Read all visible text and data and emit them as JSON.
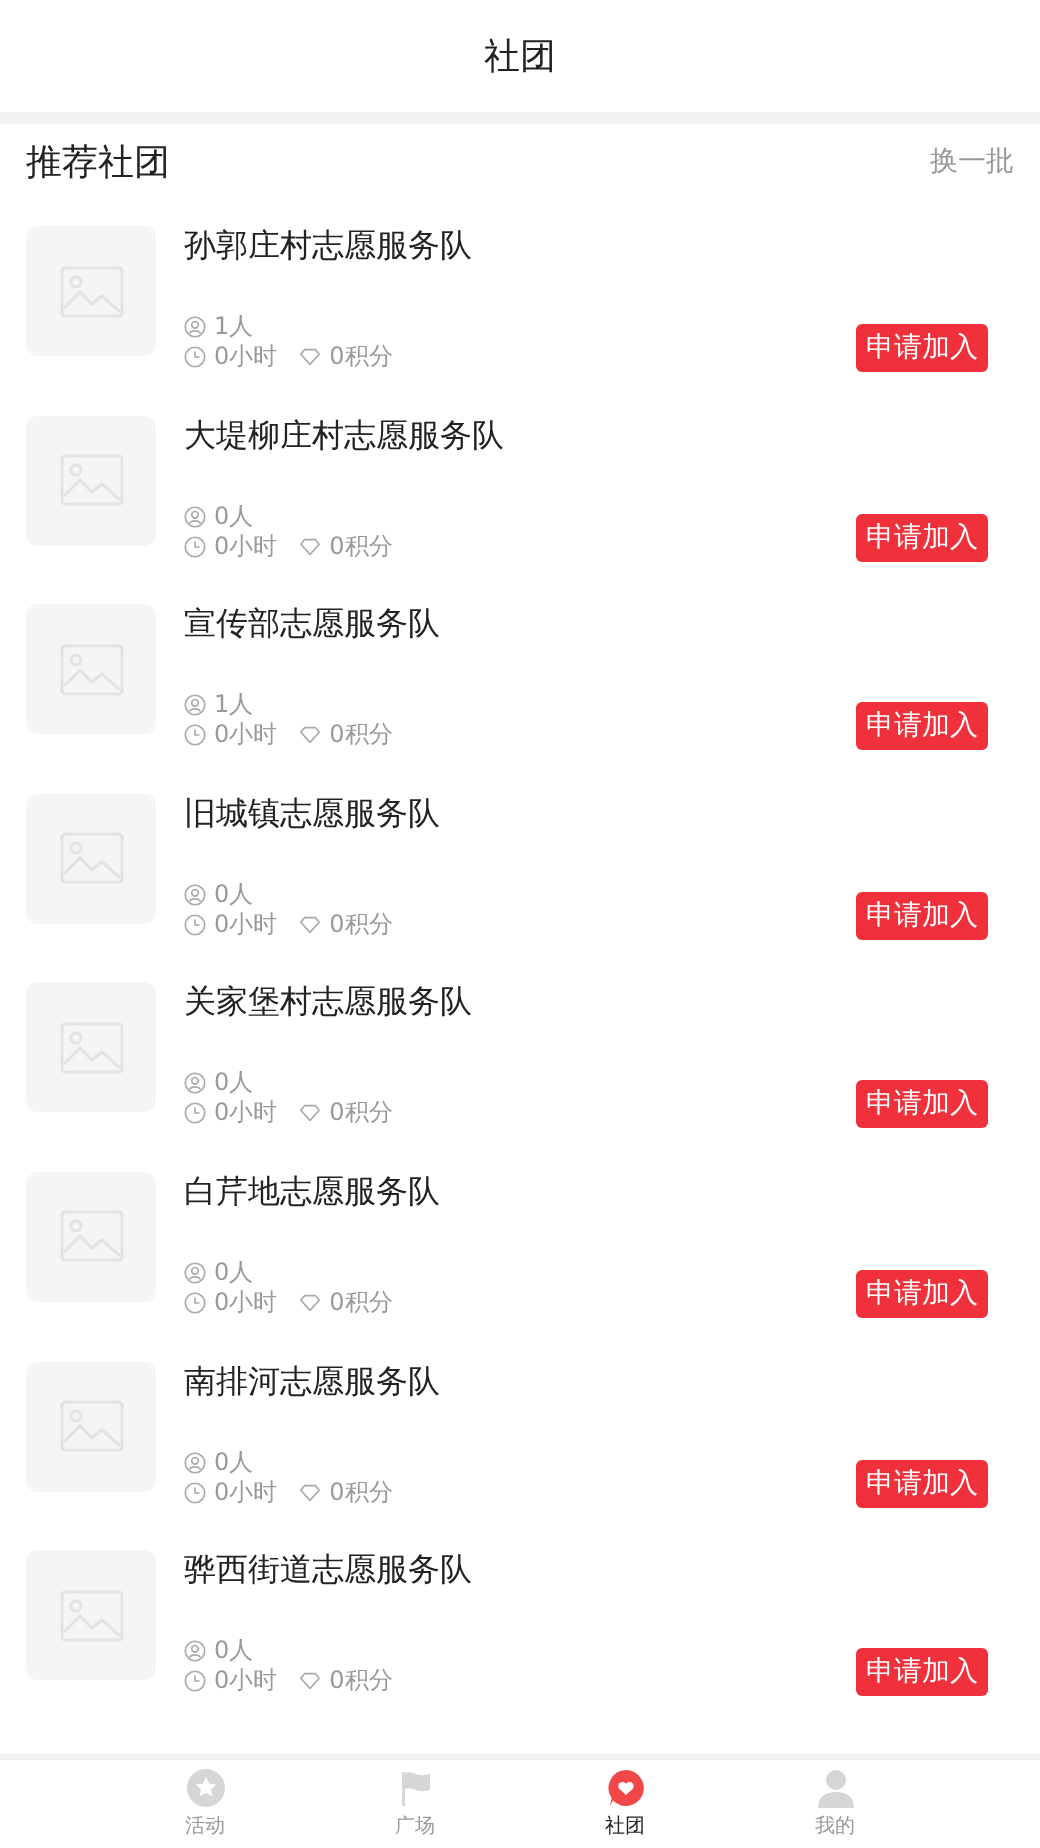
{
  "header": {
    "title": "社团"
  },
  "section": {
    "title": "推荐社团",
    "action": "换一批"
  },
  "clubs": [
    {
      "name": "孙郭庄村志愿服务队",
      "members": "1人",
      "hours": "0小时",
      "points": "0积分",
      "button": "申请加入"
    },
    {
      "name": "大堤柳庄村志愿服务队",
      "members": "0人",
      "hours": "0小时",
      "points": "0积分",
      "button": "申请加入"
    },
    {
      "name": "宣传部志愿服务队",
      "members": "1人",
      "hours": "0小时",
      "points": "0积分",
      "button": "申请加入"
    },
    {
      "name": "旧城镇志愿服务队",
      "members": "0人",
      "hours": "0小时",
      "points": "0积分",
      "button": "申请加入"
    },
    {
      "name": "关家堡村志愿服务队",
      "members": "0人",
      "hours": "0小时",
      "points": "0积分",
      "button": "申请加入"
    },
    {
      "name": "白芹地志愿服务队",
      "members": "0人",
      "hours": "0小时",
      "points": "0积分",
      "button": "申请加入"
    },
    {
      "name": "南排河志愿服务队",
      "members": "0人",
      "hours": "0小时",
      "points": "0积分",
      "button": "申请加入"
    },
    {
      "name": "骅西街道志愿服务队",
      "members": "0人",
      "hours": "0小时",
      "points": "0积分",
      "button": "申请加入"
    }
  ],
  "tabs": [
    {
      "label": "活动",
      "selected": false
    },
    {
      "label": "广场",
      "selected": false
    },
    {
      "label": "社团",
      "selected": true
    },
    {
      "label": "我的",
      "selected": false
    }
  ]
}
